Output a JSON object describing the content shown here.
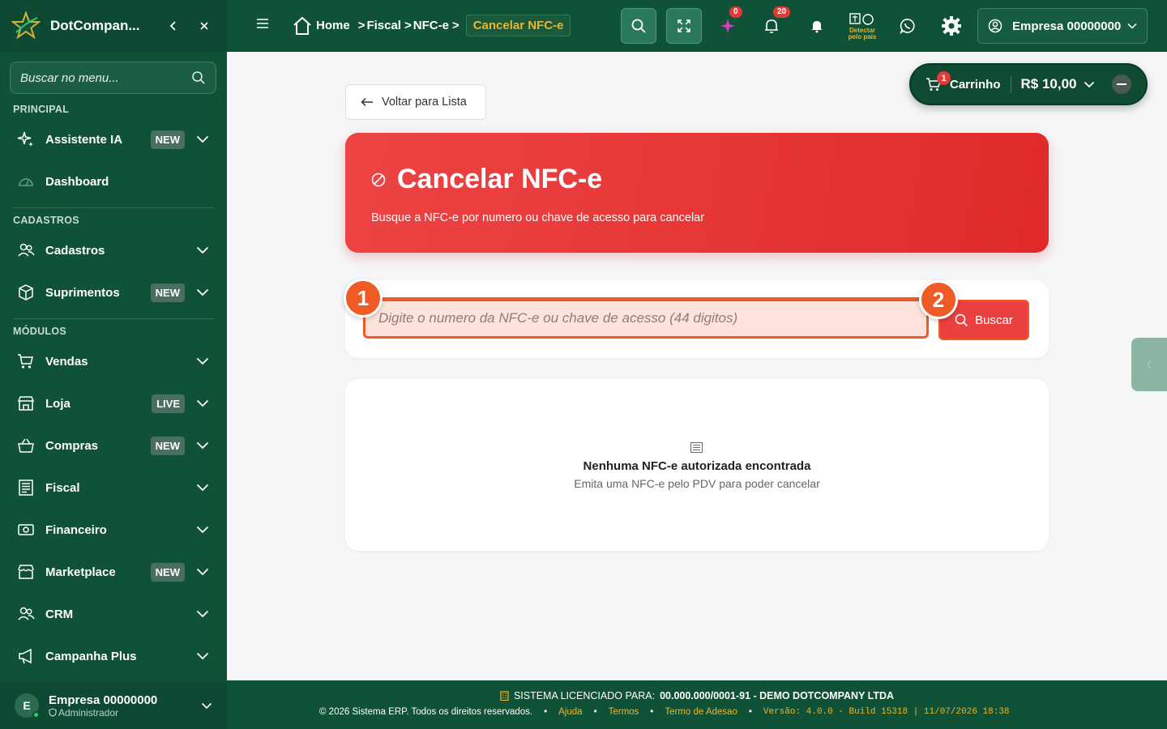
{
  "sidebar": {
    "brand": "DotCompan...",
    "search_placeholder": "Buscar no menu...",
    "sections": {
      "principal": "PRINCIPAL",
      "cadastros": "CADASTROS",
      "modulos": "MÓDULOS"
    },
    "items": [
      {
        "label": "Assistente IA",
        "badge": "NEW",
        "icon": "sparkles-icon"
      },
      {
        "label": "Dashboard",
        "badge": "",
        "icon": "gauge-icon"
      },
      {
        "label": "Cadastros",
        "badge": "",
        "icon": "users-icon"
      },
      {
        "label": "Suprimentos",
        "badge": "NEW",
        "icon": "box-icon"
      },
      {
        "label": "Vendas",
        "badge": "",
        "icon": "cart-icon"
      },
      {
        "label": "Loja",
        "badge": "LIVE",
        "icon": "store-icon"
      },
      {
        "label": "Compras",
        "badge": "NEW",
        "icon": "basket-icon"
      },
      {
        "label": "Fiscal",
        "badge": "",
        "icon": "receipt-icon"
      },
      {
        "label": "Financeiro",
        "badge": "",
        "icon": "cash-icon"
      },
      {
        "label": "Marketplace",
        "badge": "NEW",
        "icon": "shop-icon"
      },
      {
        "label": "CRM",
        "badge": "",
        "icon": "users-icon"
      },
      {
        "label": "Campanha Plus",
        "badge": "",
        "icon": "megaphone-icon"
      }
    ],
    "user": {
      "initial": "E",
      "name": "Empresa 00000000",
      "role": "Administrador"
    }
  },
  "topbar": {
    "breadcrumb": [
      "Home",
      "Fiscal",
      "NFC-e"
    ],
    "breadcrumb_active": "Cancelar NFC-e",
    "ai_badge": "0",
    "notif_badge": "20",
    "detect_label_1": "Detectar",
    "detect_label_2": "pelo país",
    "company": "Empresa 00000000"
  },
  "cart": {
    "badge": "1",
    "label": "Carrinho",
    "amount": "R$ 10,00"
  },
  "main": {
    "back_label": "Voltar para Lista",
    "title": "Cancelar NFC-e",
    "subtitle": "Busque a NFC-e por numero ou chave de acesso para cancelar",
    "input_placeholder": "Digite o numero da NFC-e ou chave de acesso (44 digitos)",
    "search_button": "Buscar",
    "marker_1": "1",
    "marker_2": "2",
    "empty_title": "Nenhuma NFC-e autorizada encontrada",
    "empty_subtitle": "Emita uma NFC-e pelo PDV para poder cancelar"
  },
  "footer": {
    "license_prefix": "SISTEMA LICENCIADO PARA:",
    "license_value": "00.000.000/0001-91 - DEMO DOTCOMPANY LTDA",
    "copyright": "© 2026 Sistema ERP. Todos os direitos reservados.",
    "links": [
      "Ajuda",
      "Termos",
      "Termo de Adesao"
    ],
    "version": "Versão: 4.0.0 - Build 15318 | 11/07/2026 18:38"
  },
  "colors": {
    "sidebar": "#0f5238",
    "accent_red": "#e53935",
    "marker_orange": "#f05a24",
    "gold": "#f0b429"
  }
}
